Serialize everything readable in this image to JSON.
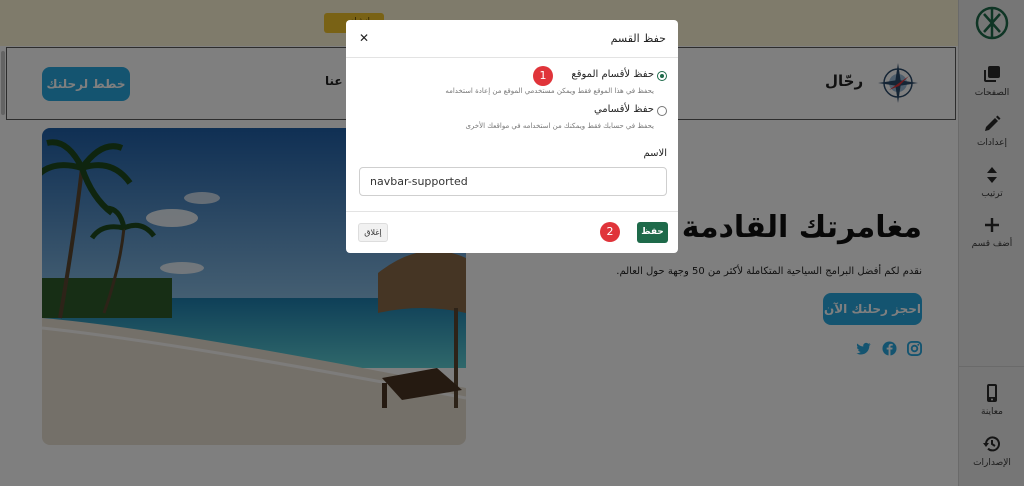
{
  "notice": {
    "button_label": "إنشاء"
  },
  "site": {
    "brand_name": "رحّال",
    "nav_link": "عنا",
    "nav_cta": "خطط لرحلتك",
    "hero_title": "مغامرتك القادمة تبدأ",
    "hero_description": "نقدم لكم أفضل البرامج السياحية المتكاملة لأكثر من 50 وجهة حول العالم.",
    "hero_button": "احجز رحلتك الآن",
    "social_icons": [
      "instagram-icon",
      "facebook-icon",
      "twitter-icon"
    ]
  },
  "sidebar": {
    "items": [
      {
        "label": "الصفحات",
        "icon": "pages-icon"
      },
      {
        "label": "إعدادات",
        "icon": "pencil-icon"
      },
      {
        "label": "ترتيب",
        "icon": "sort-icon"
      },
      {
        "label": "أضف قسم",
        "icon": "plus-icon"
      },
      {
        "label": "معاينة",
        "icon": "mobile-icon"
      },
      {
        "label": "الإصدارات",
        "icon": "history-icon"
      }
    ]
  },
  "modal": {
    "title": "حفظ القسم",
    "options": [
      {
        "label": "حفظ لأقسام الموقع",
        "help": "يحفظ في هذا الموقع فقط ويمكن مستخدمي الموقع من إعادة استخدامه",
        "selected": true
      },
      {
        "label": "حفظ لأقسامي",
        "help": "يحفظ في حسابك فقط ويمكنك من استخدامه في مواقعك الأخرى",
        "selected": false
      }
    ],
    "name_label": "الاسم",
    "name_value": "navbar-supported",
    "save_label": "حفظ",
    "close_label": "إغلاق"
  },
  "annotations": {
    "badge_1": "1",
    "badge_2": "2"
  },
  "colors": {
    "primary_green": "#1e6a4a",
    "accent_blue": "#29a9e1",
    "badge_red": "#e0343a"
  }
}
